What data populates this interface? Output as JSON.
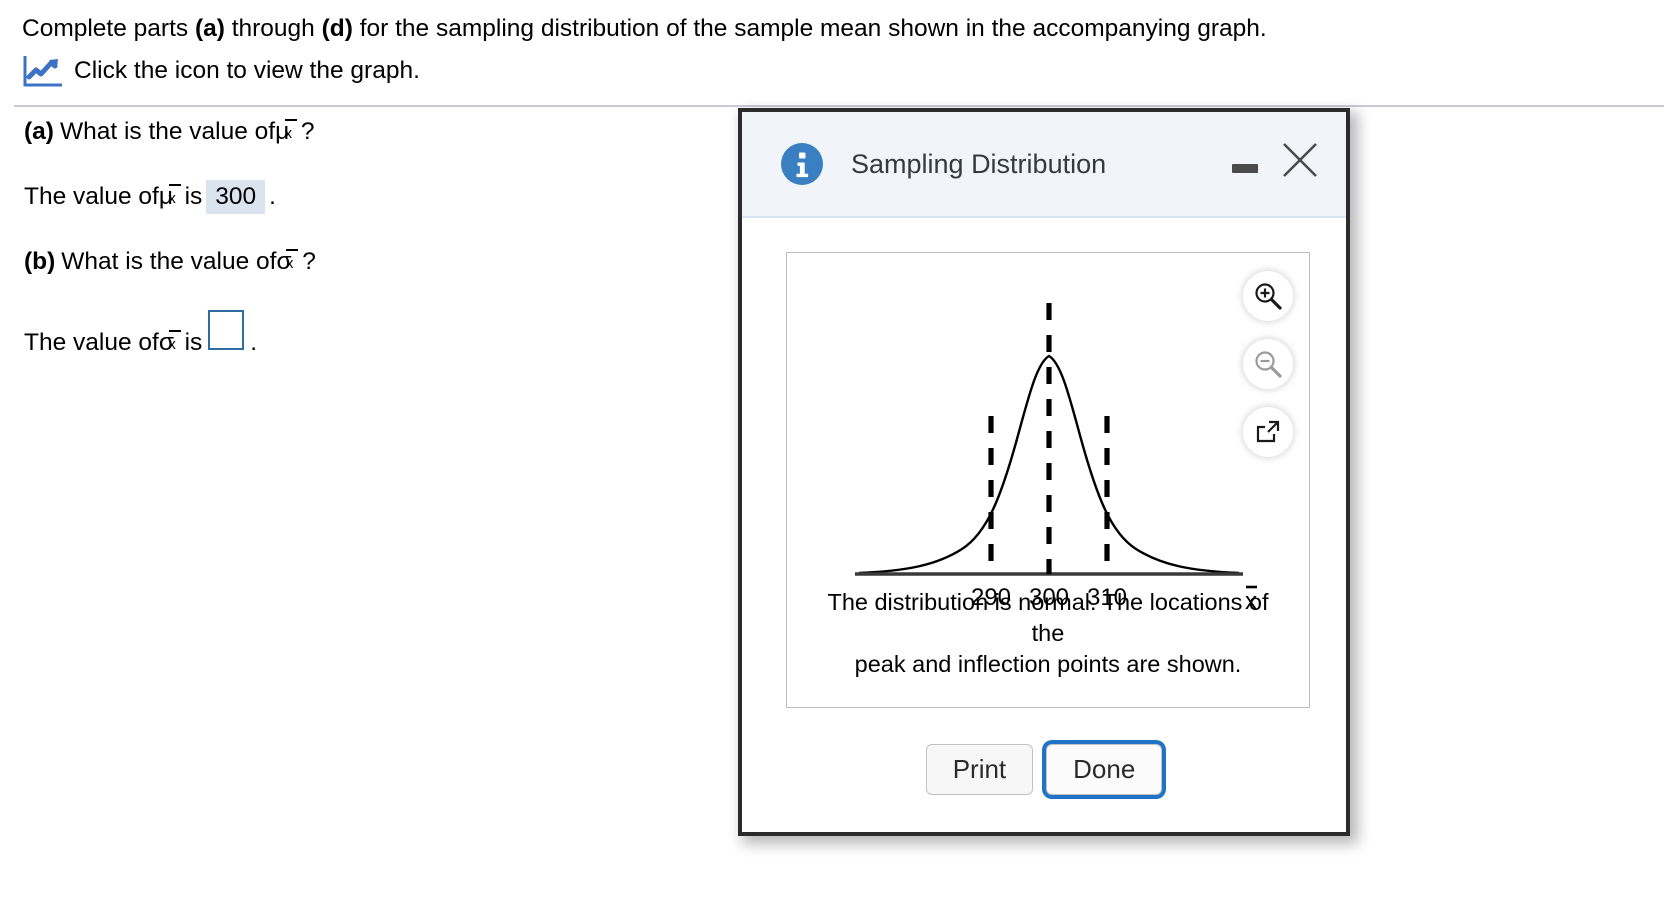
{
  "problem": {
    "line1_a": "Complete parts ",
    "line1_b1": "(a)",
    "line1_c": " through ",
    "line1_b2": "(d)",
    "line1_d": " for the sampling distribution of the sample mean shown in the accompanying graph.",
    "icon_name": "line-chart-icon",
    "link_text": "Click the icon to view the graph."
  },
  "parts": {
    "a_label": "(a)",
    "a_question_pre": "What is the value of ",
    "a_question_post": "?",
    "a_symbol_base": "μ",
    "a_symbol_sub": "x",
    "a_answer_pre": "The value of ",
    "a_answer_mid": " is ",
    "a_answer_value": "300",
    "a_answer_post": ".",
    "b_label": "(b)",
    "b_question_pre": "What is the value of ",
    "b_question_post": "?",
    "b_symbol_base": "σ",
    "b_symbol_sub": "x",
    "b_answer_pre": "The value of ",
    "b_answer_mid": " is ",
    "b_answer_value": "",
    "b_answer_post": "."
  },
  "dialog": {
    "title": "Sampling Distribution",
    "info_icon": "info-circle-icon",
    "minimize_icon": "minimize-icon",
    "close_icon": "close-x-icon",
    "tools": [
      {
        "name": "zoom-in-icon",
        "state": "enabled"
      },
      {
        "name": "zoom-out-icon",
        "state": "disabled"
      },
      {
        "name": "pop-out-icon",
        "state": "enabled"
      }
    ],
    "caption_line1": "The distribution is normal. The locations of the",
    "caption_line2": "peak and inflection points are shown.",
    "print_label": "Print",
    "done_label": "Done",
    "colors": {
      "header_bg": "#f1f5fa",
      "border": "#2b2b2b",
      "info_blue": "#3a7fc1",
      "focus_blue": "#1f74c8",
      "answer_highlight": "#dbe3ef",
      "input_border": "#2e6da4"
    }
  },
  "chart_data": {
    "type": "line",
    "title": "",
    "xlabel": "x̄",
    "ylabel": "",
    "distribution": "normal",
    "mean": 300,
    "sd": 10,
    "tick_labels": [
      "290",
      "300",
      "310"
    ],
    "tick_values": [
      290,
      300,
      310
    ],
    "markers": [
      {
        "x": 290,
        "type": "inflection-point",
        "style": "dashed-vertical"
      },
      {
        "x": 300,
        "type": "peak",
        "style": "dashed-vertical"
      },
      {
        "x": 310,
        "type": "inflection-point",
        "style": "dashed-vertical"
      }
    ],
    "axis_label": "x̄",
    "grid": false,
    "legend": "none",
    "xlim": [
      265,
      335
    ]
  }
}
